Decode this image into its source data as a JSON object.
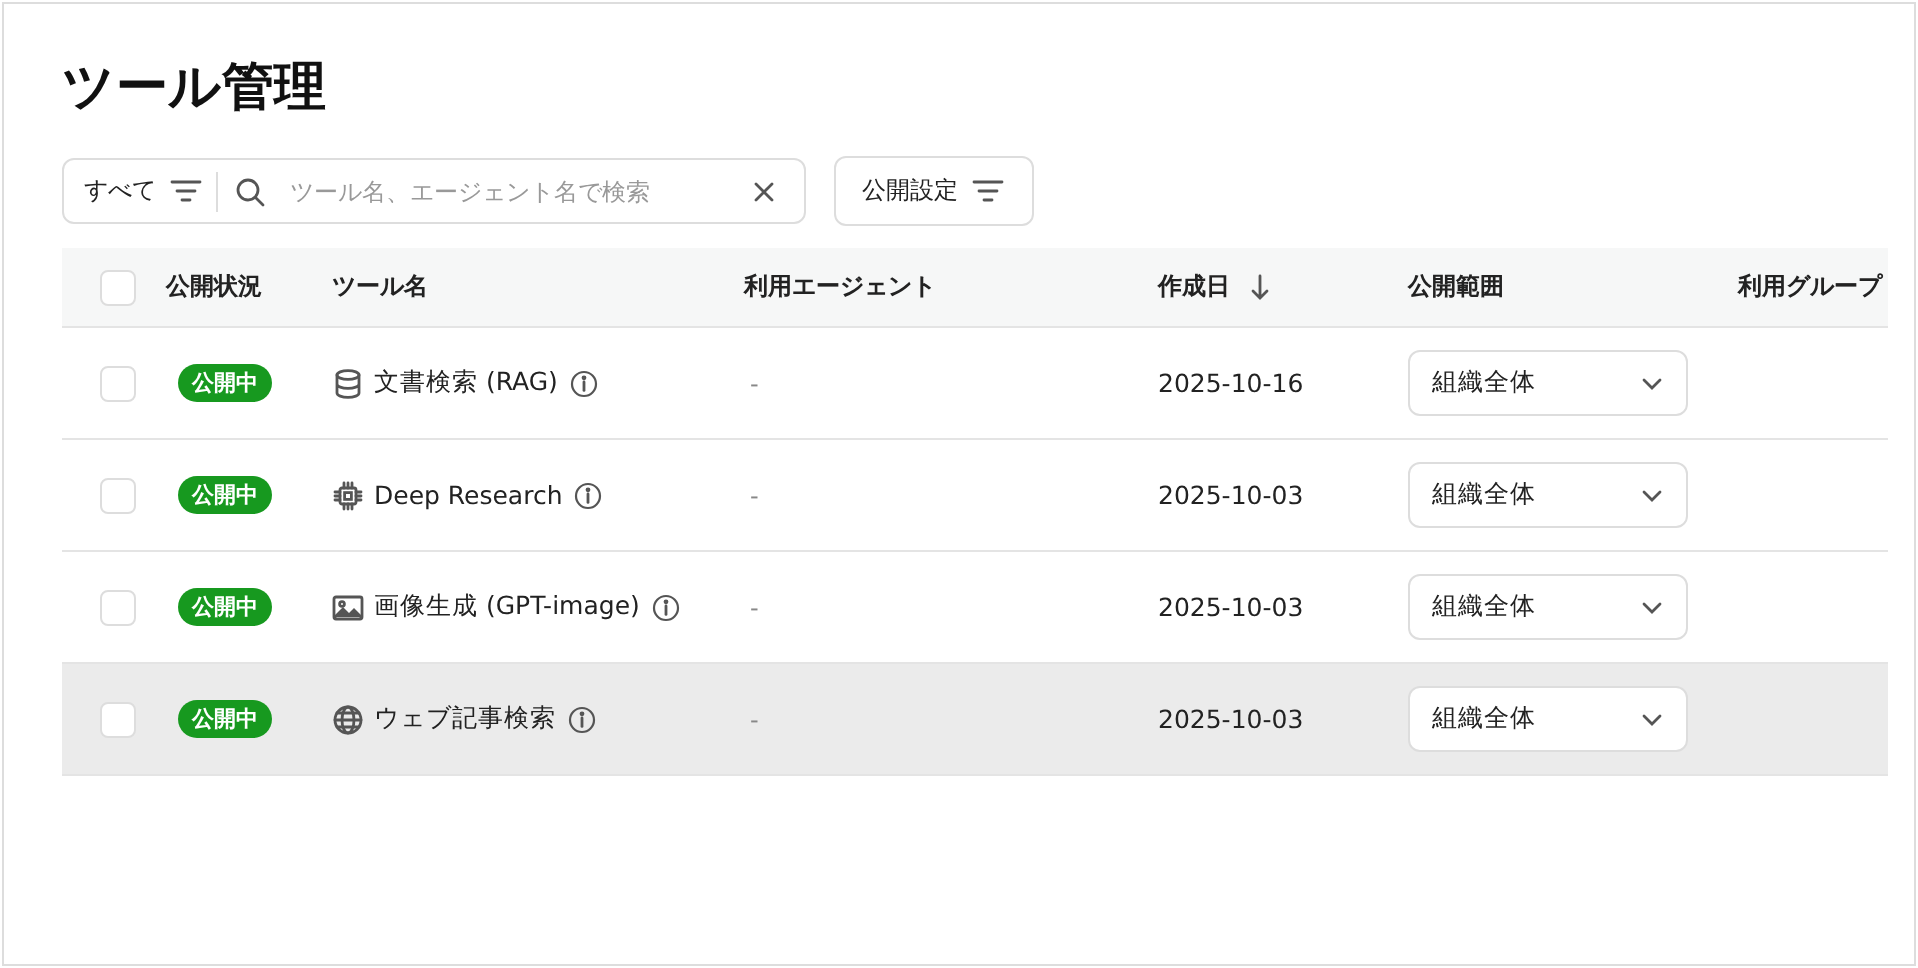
{
  "page_title": "ツール管理",
  "filter": {
    "label": "すべて"
  },
  "search": {
    "placeholder": "ツール名、エージェント名で検索"
  },
  "publish_button": {
    "label": "公開設定"
  },
  "table": {
    "columns": [
      {
        "label": "公開状況",
        "sorted": false
      },
      {
        "label": "ツール名",
        "sorted": false
      },
      {
        "label": "利用エージェント",
        "sorted": false
      },
      {
        "label": "作成日",
        "sorted": true
      },
      {
        "label": "公開範囲",
        "sorted": false
      },
      {
        "label": "利用グループ",
        "sorted": false
      }
    ],
    "header_checked": false,
    "rows": [
      {
        "checked": false,
        "highlighted": false,
        "status": "公開中",
        "kind": "database",
        "name": "文書検索 (RAG)",
        "agent": "-",
        "created": "2025-10-16",
        "scope": "組織全体"
      },
      {
        "checked": false,
        "highlighted": false,
        "status": "公開中",
        "kind": "chip",
        "name": "Deep Research",
        "agent": "-",
        "created": "2025-10-03",
        "scope": "組織全体"
      },
      {
        "checked": false,
        "highlighted": false,
        "status": "公開中",
        "kind": "image",
        "name": "画像生成 (GPT-image)",
        "agent": "-",
        "created": "2025-10-03",
        "scope": "組織全体"
      },
      {
        "checked": false,
        "highlighted": true,
        "status": "公開中",
        "kind": "globe",
        "name": "ウェブ記事検索",
        "agent": "-",
        "created": "2025-10-03",
        "scope": "組織全体"
      }
    ]
  }
}
